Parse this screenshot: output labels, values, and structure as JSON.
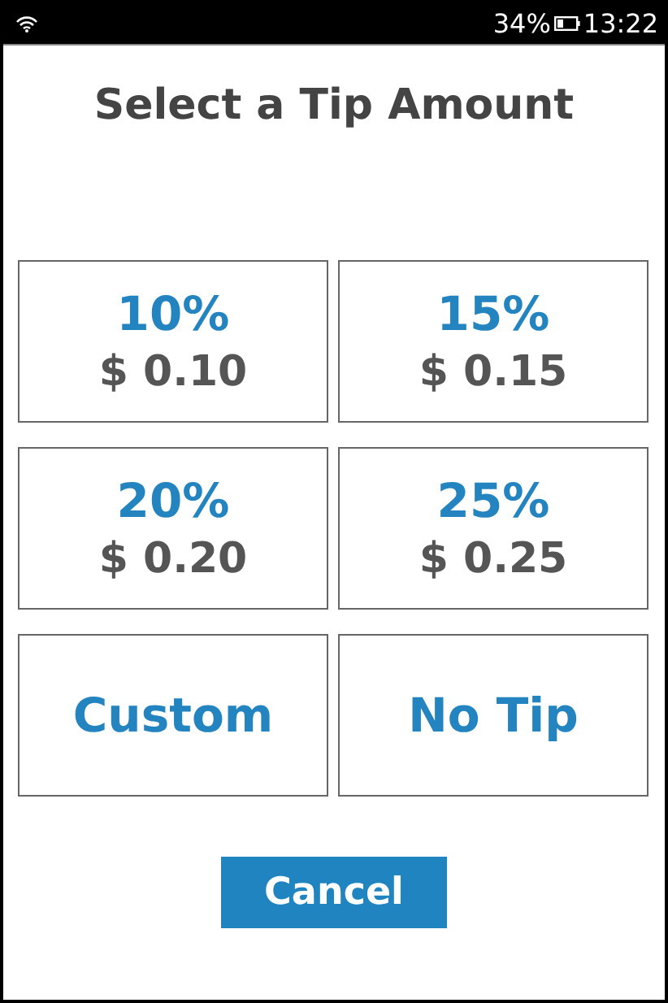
{
  "status_bar": {
    "battery": "34%",
    "time": "13:22"
  },
  "title": "Select a Tip Amount",
  "options": [
    {
      "kind": "percent",
      "label": "10%",
      "amount": "$ 0.10"
    },
    {
      "kind": "percent",
      "label": "15%",
      "amount": "$ 0.15"
    },
    {
      "kind": "percent",
      "label": "20%",
      "amount": "$ 0.20"
    },
    {
      "kind": "percent",
      "label": "25%",
      "amount": "$ 0.25"
    },
    {
      "kind": "plain",
      "label": "Custom"
    },
    {
      "kind": "plain",
      "label": "No Tip"
    }
  ],
  "cancel": "Cancel"
}
